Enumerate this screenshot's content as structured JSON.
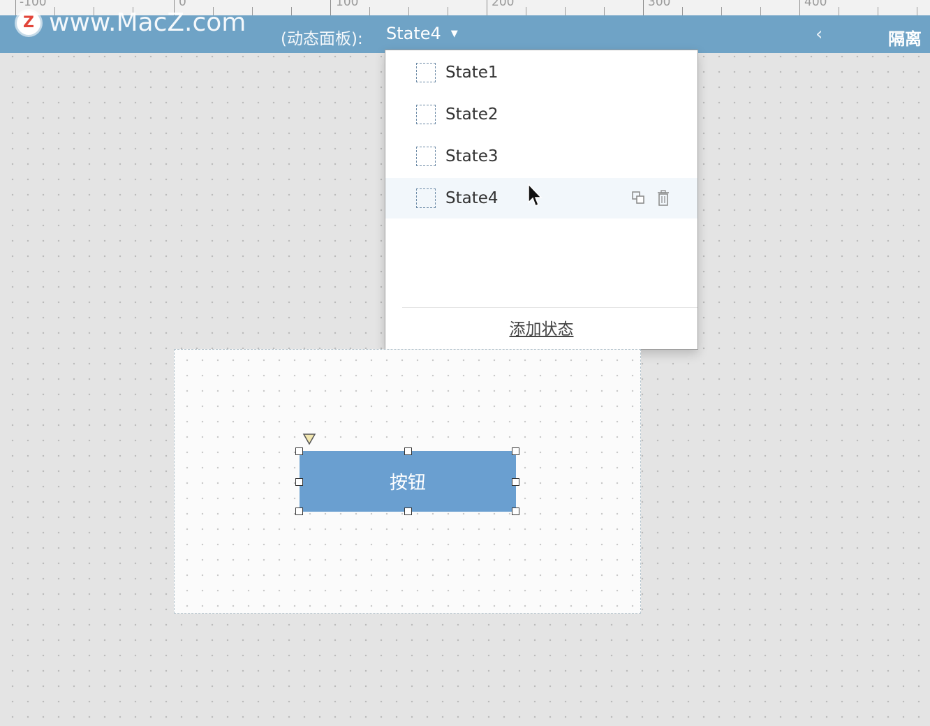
{
  "ruler": {
    "labels": [
      "-100",
      "0",
      "100",
      "200",
      "300",
      "400"
    ]
  },
  "watermark": {
    "logo_letter": "Z",
    "text": "www.MacZ.com"
  },
  "toolbar": {
    "panel_label": "(动态面板):",
    "selected_state": "State4",
    "back_icon": "chevron-left-icon",
    "isolate_label": "隔离"
  },
  "dropdown": {
    "states": [
      {
        "label": "State1"
      },
      {
        "label": "State2"
      },
      {
        "label": "State3"
      },
      {
        "label": "State4"
      }
    ],
    "row_actions": [
      "duplicate-icon",
      "trash-icon"
    ],
    "add_state_label": "添加状态"
  },
  "canvas": {
    "button_label": "按钮"
  },
  "colors": {
    "toolbar_bg": "#6fa3c6",
    "button_bg": "#6a9fd0",
    "canvas_bg": "#e4e4e4"
  }
}
